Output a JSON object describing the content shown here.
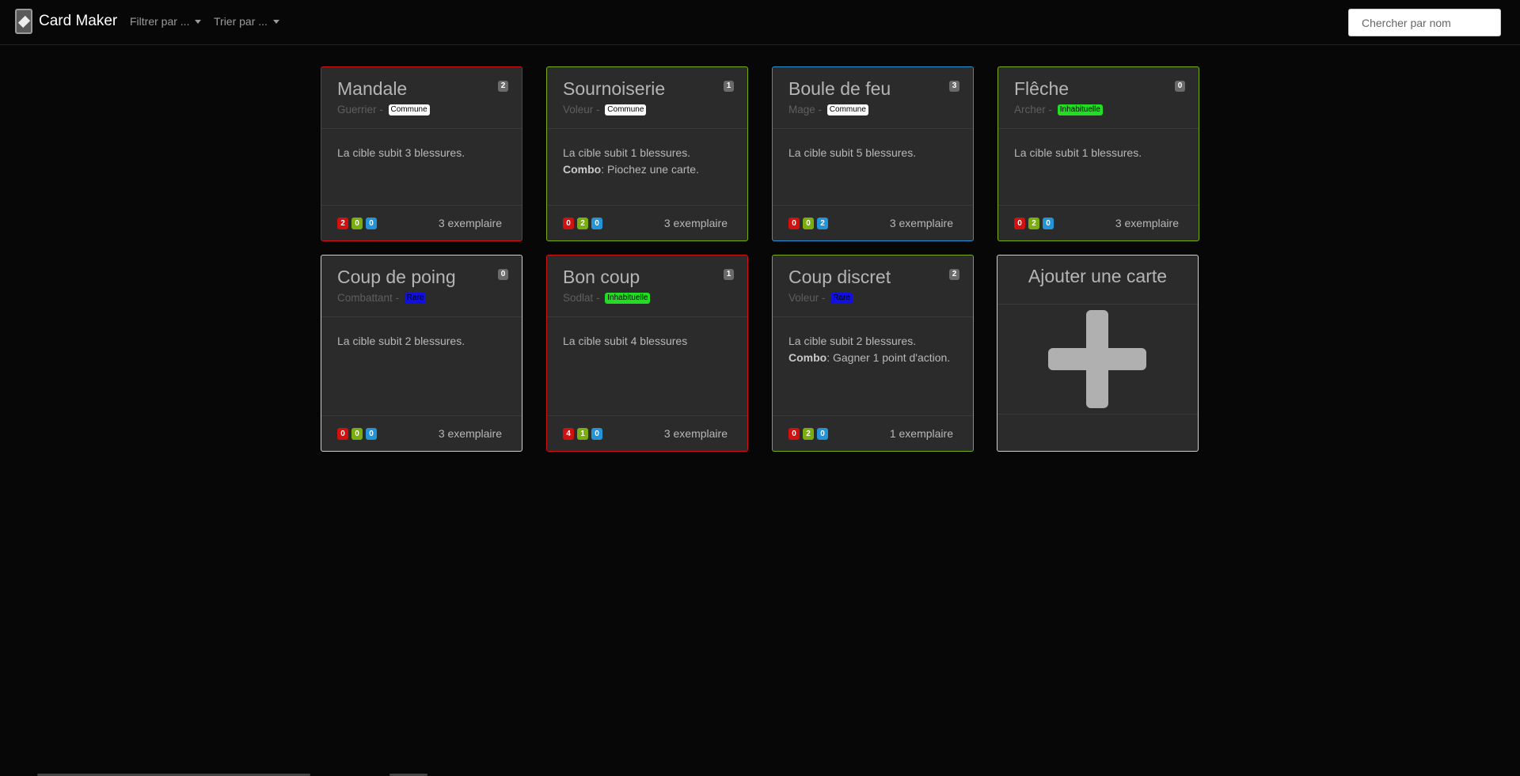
{
  "navbar": {
    "brand": "Card Maker",
    "filter_label": "Filtrer par ...",
    "sort_label": "Trier par ...",
    "search_placeholder": "Chercher par nom"
  },
  "colors": {
    "red": "#d11010",
    "green": "#7aae10",
    "blue": "#2494d8",
    "white": "#cfcfcf",
    "commune": "#ffffff",
    "inhabituelle": "#22dd22",
    "rare": "#1010e0"
  },
  "cards": [
    {
      "name": "Mandale",
      "cost": "2",
      "class": "Guerrier",
      "rarity": "Commune",
      "text": "La cible subit 3 blessures.",
      "combo": "",
      "stats": [
        "2",
        "0",
        "0"
      ],
      "count": "3 exemplaire",
      "border": "red"
    },
    {
      "name": "Sournoiserie",
      "cost": "1",
      "class": "Voleur",
      "rarity": "Commune",
      "text": "La cible subit 1 blessures.",
      "combo": "Piochez une carte.",
      "stats": [
        "0",
        "2",
        "0"
      ],
      "count": "3 exemplaire",
      "border": "green"
    },
    {
      "name": "Boule de feu",
      "cost": "3",
      "class": "Mage",
      "rarity": "Commune",
      "text": "La cible subit 5 blessures.",
      "combo": "",
      "stats": [
        "0",
        "0",
        "2"
      ],
      "count": "3 exemplaire",
      "border": "blue"
    },
    {
      "name": "Flêche",
      "cost": "0",
      "class": "Archer",
      "rarity": "Inhabituelle",
      "text": "La cible subit 1 blessures.",
      "combo": "",
      "stats": [
        "0",
        "2",
        "0"
      ],
      "count": "3 exemplaire",
      "border": "green"
    },
    {
      "name": "Coup de poing",
      "cost": "0",
      "class": "Combattant",
      "rarity": "Rare",
      "text": "La cible subit 2 blessures.",
      "combo": "",
      "stats": [
        "0",
        "0",
        "0"
      ],
      "count": "3 exemplaire",
      "border": "white"
    },
    {
      "name": "Bon coup",
      "cost": "1",
      "class": "Sodlat",
      "rarity": "Inhabituelle",
      "text": "La cible subit 4 blessures",
      "combo": "",
      "stats": [
        "4",
        "1",
        "0"
      ],
      "count": "3 exemplaire",
      "border": "red"
    },
    {
      "name": "Coup discret",
      "cost": "2",
      "class": "Voleur",
      "rarity": "Rare",
      "text": "La cible subit 2 blessures.",
      "combo": "Gagner 1 point d'action.",
      "stats": [
        "0",
        "2",
        "0"
      ],
      "count": "1 exemplaire",
      "border": "green"
    }
  ],
  "combo_label": "Combo",
  "class_separator": " - ",
  "add_card": {
    "label": "Ajouter une carte"
  }
}
